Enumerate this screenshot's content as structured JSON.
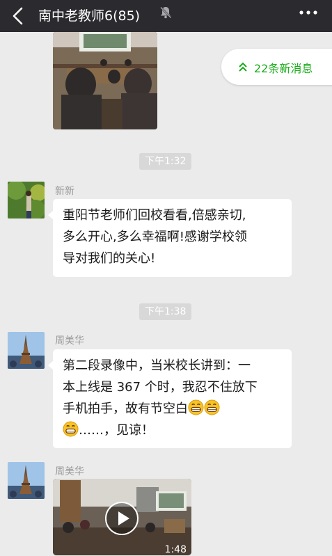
{
  "header": {
    "title": "南中老教师6(85)",
    "back_icon": "chevron-left-icon",
    "mute_icon": "bell-off-icon",
    "more_icon": "more-dots-icon"
  },
  "new_messages": {
    "label": "22条新消息",
    "icon": "double-chevron-up-icon"
  },
  "messages": [
    {
      "time": "下午1:32",
      "sender": "新新",
      "text_lines": [
        "重阳节老师们回校看看,倍感亲切,",
        "多么开心,多么幸福啊!感谢学校领",
        "导对我们的关心!"
      ]
    },
    {
      "time": "下午1:38",
      "sender": "周美华",
      "text_lines": [
        "第二段录像中，当米校长讲到：一",
        "本上线是 367 个时，我忍不住放下",
        "手机拍手，故有节空白",
        "……，见谅！"
      ]
    },
    {
      "sender": "周美华",
      "video_duration": "1:48"
    }
  ],
  "colors": {
    "header_bg": "#2b2b2f",
    "chat_bg": "#ebebeb",
    "accent_green": "#1aad19"
  }
}
